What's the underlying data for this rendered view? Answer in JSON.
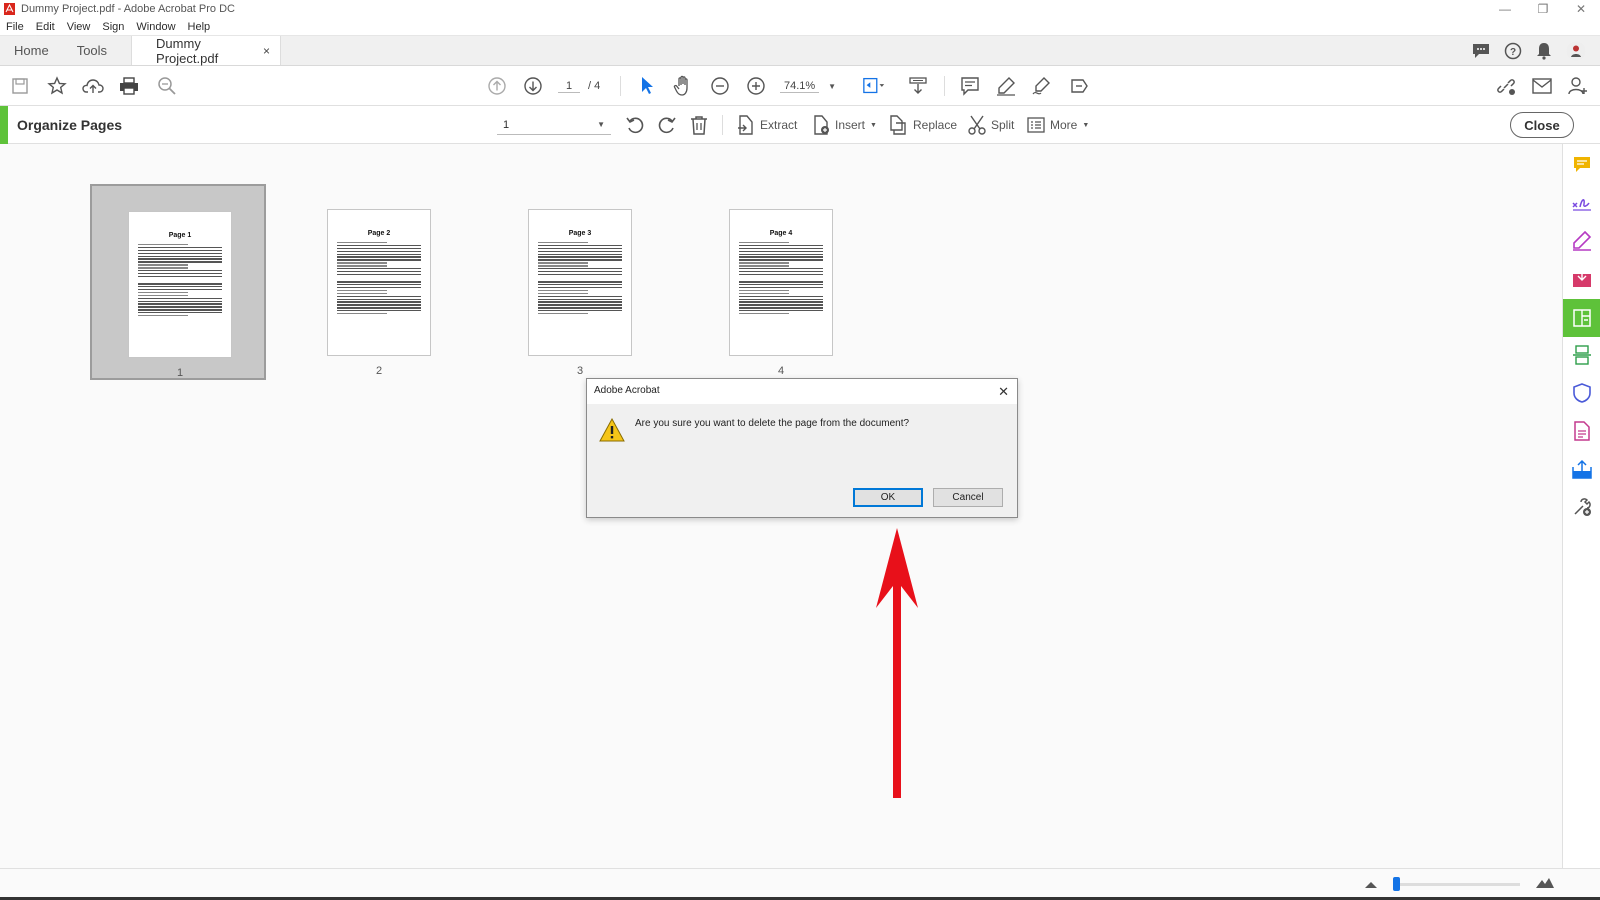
{
  "window": {
    "title": "Dummy Project.pdf - Adobe Acrobat Pro DC",
    "minimize": "—",
    "maximize": "❐",
    "close": "✕"
  },
  "menu": [
    "File",
    "Edit",
    "View",
    "Sign",
    "Window",
    "Help"
  ],
  "tabs": {
    "home": "Home",
    "tools": "Tools",
    "document": "Dummy Project.pdf",
    "document_close": "×"
  },
  "toolbar": {
    "current_page": "1",
    "page_total": "/ 4",
    "zoom": "74.1%"
  },
  "organize": {
    "title": "Organize Pages",
    "page_selector": "1",
    "extract": "Extract",
    "insert": "Insert",
    "replace": "Replace",
    "split": "Split",
    "more": "More",
    "close": "Close"
  },
  "pages": [
    {
      "title": "Page 1",
      "number": "1",
      "selected": true
    },
    {
      "title": "Page 2",
      "number": "2",
      "selected": false
    },
    {
      "title": "Page 3",
      "number": "3",
      "selected": false
    },
    {
      "title": "Page 4",
      "number": "4",
      "selected": false
    }
  ],
  "dialog": {
    "title": "Adobe Acrobat",
    "message": "Are you sure you want to delete the page from the document?",
    "ok": "OK",
    "cancel": "Cancel",
    "close": "✕"
  },
  "colors": {
    "accent_green": "#5ec23a",
    "arrow_red": "#e8101a",
    "selection_blue": "#1473e6"
  },
  "right_panel_icons": [
    "comment-icon",
    "fill-sign-icon",
    "edit-pdf-icon",
    "export-pdf-icon",
    "organize-pages-icon",
    "scan-icon",
    "protect-icon",
    "create-pdf-icon",
    "share-icon",
    "more-tools-icon"
  ]
}
